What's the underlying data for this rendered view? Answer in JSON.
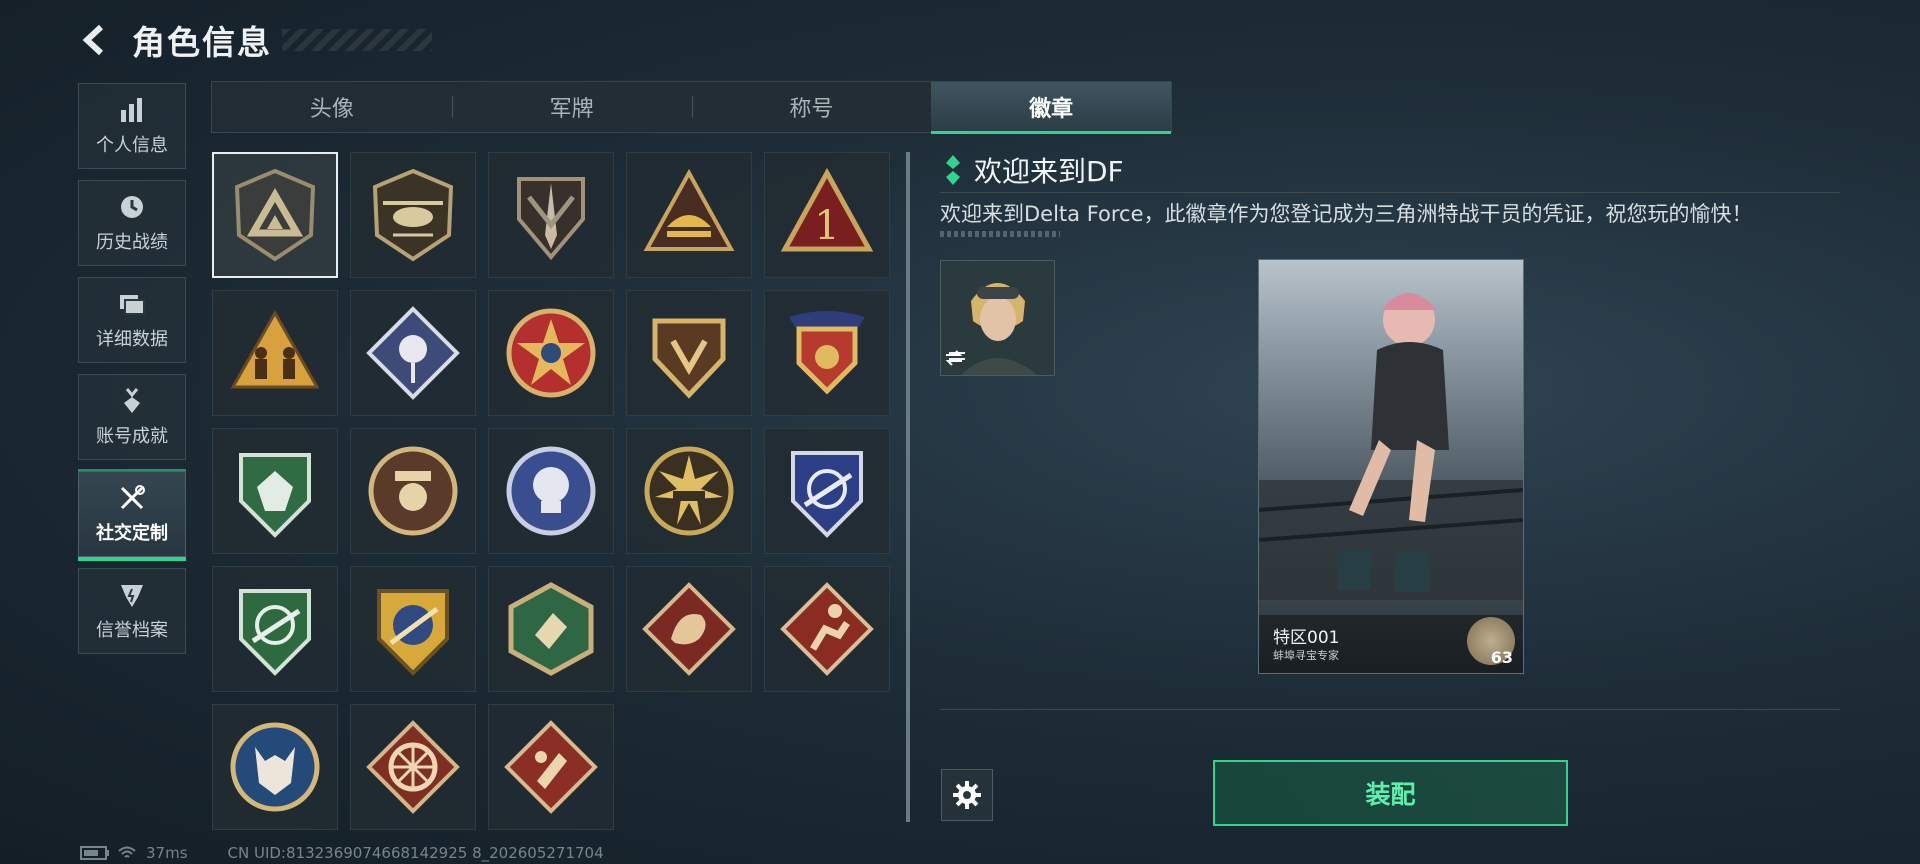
{
  "header": {
    "title": "角色信息",
    "back_icon": "back-arrow-icon"
  },
  "sidebar": {
    "items": [
      {
        "label": "个人信息",
        "icon": "bar-chart-icon"
      },
      {
        "label": "历史战绩",
        "icon": "clock-icon"
      },
      {
        "label": "详细数据",
        "icon": "folders-icon"
      },
      {
        "label": "账号成就",
        "icon": "medal-icon"
      },
      {
        "label": "社交定制",
        "icon": "tools-icon",
        "active": true
      },
      {
        "label": "信誉档案",
        "icon": "shield-icon"
      }
    ]
  },
  "tabs": [
    {
      "label": "头像"
    },
    {
      "label": "军牌"
    },
    {
      "label": "称号"
    },
    {
      "label": "徽章",
      "active": true
    }
  ],
  "badges": [
    "delta-triangle-badge",
    "helicopter-badge",
    "dagger-shield-badge",
    "helmet-triangle-badge",
    "number-one-badge",
    "soldiers-triangle-badge",
    "rose-diamond-badge",
    "star-wheel-badge",
    "delta-shield-badge",
    "crest-banner-badge",
    "green-gem-badge",
    "hat-skull-badge",
    "blue-skull-badge",
    "tank-badge",
    "sniper-blue-badge",
    "sniper-green-badge",
    "gold-rifle-badge",
    "hex-hands-badge",
    "dragon-badge",
    "runner-badge",
    "wolf-badge",
    "wheel-badge",
    "red-rune-badge"
  ],
  "detail": {
    "title": "欢迎来到DF",
    "description": "欢迎来到Delta Force，此徽章作为您登记成为三角洲特战干员的凭证，祝您玩的愉快！",
    "card": {
      "name": "特区001",
      "subtitle": "蚌埠寻宝专家",
      "level": "63"
    },
    "equip_label": "装配"
  },
  "status": {
    "ping": "37ms",
    "uid": "CN UID:8132369074668142925 8_202605271704"
  },
  "colors": {
    "accent": "#2fd58f",
    "background": "#1e2d38",
    "panel": "#222c33"
  }
}
